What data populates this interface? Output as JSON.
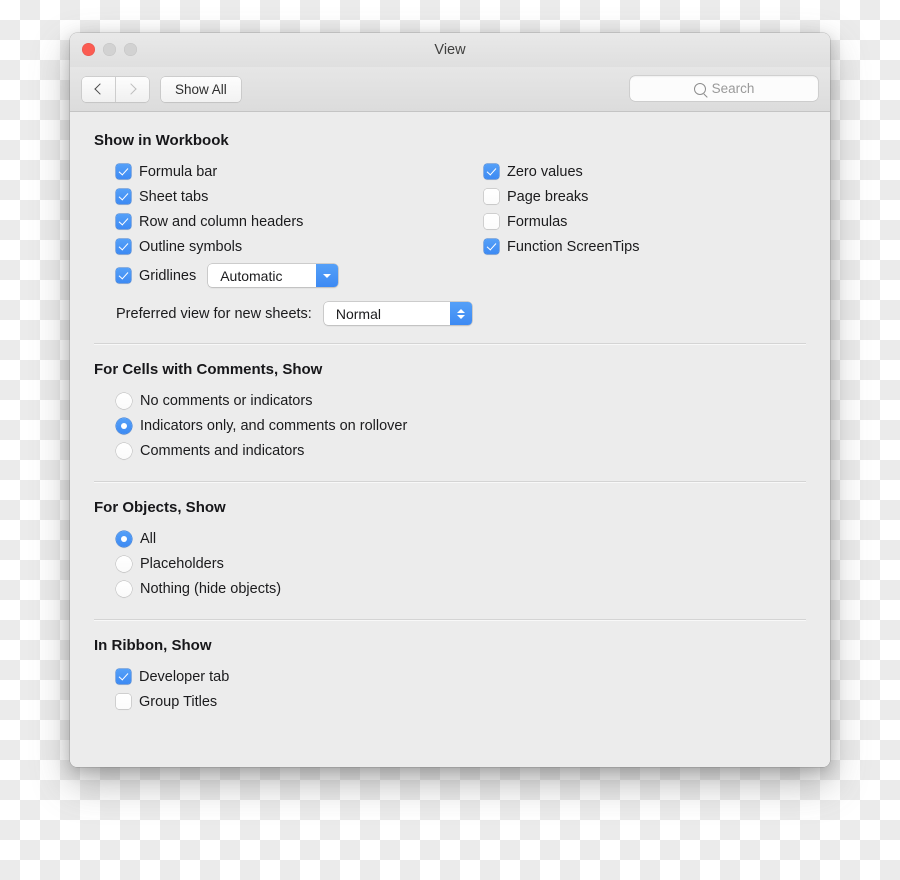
{
  "window": {
    "title": "View",
    "traffic_lights": [
      "close",
      "minimize",
      "maximize"
    ]
  },
  "toolbar": {
    "back_label": "",
    "forward_label": "",
    "show_all_label": "Show All",
    "search_placeholder": "Search",
    "search_value": ""
  },
  "colors": {
    "accent": "#3d8af3",
    "close_button": "#fb5c52",
    "window_background": "#ececec",
    "toolbar_background": "#e1e1e1"
  },
  "sections": {
    "workbook": {
      "title": "Show in Workbook",
      "left_items": [
        {
          "label": "Formula bar",
          "checked": true
        },
        {
          "label": "Sheet tabs",
          "checked": true
        },
        {
          "label": "Row and column headers",
          "checked": true
        },
        {
          "label": "Outline symbols",
          "checked": true
        },
        {
          "label": "Gridlines",
          "checked": true
        }
      ],
      "right_items": [
        {
          "label": "Zero values",
          "checked": true
        },
        {
          "label": "Page breaks",
          "checked": false
        },
        {
          "label": "Formulas",
          "checked": false
        },
        {
          "label": "Function ScreenTips",
          "checked": true
        }
      ],
      "gridlines_color": {
        "value": "Automatic",
        "options": [
          "Automatic"
        ]
      },
      "preferred_view": {
        "label": "Preferred view for new sheets:",
        "value": "Normal",
        "options": [
          "Normal"
        ]
      }
    },
    "comments": {
      "title": "For Cells with Comments, Show",
      "options": [
        {
          "label": "No comments or indicators",
          "selected": false
        },
        {
          "label": "Indicators only, and comments on rollover",
          "selected": true
        },
        {
          "label": "Comments and indicators",
          "selected": false
        }
      ]
    },
    "objects": {
      "title": "For Objects, Show",
      "options": [
        {
          "label": "All",
          "selected": true
        },
        {
          "label": "Placeholders",
          "selected": false
        },
        {
          "label": "Nothing (hide objects)",
          "selected": false
        }
      ]
    },
    "ribbon": {
      "title": "In Ribbon, Show",
      "items": [
        {
          "label": "Developer tab",
          "checked": true
        },
        {
          "label": "Group Titles",
          "checked": false
        }
      ]
    }
  }
}
